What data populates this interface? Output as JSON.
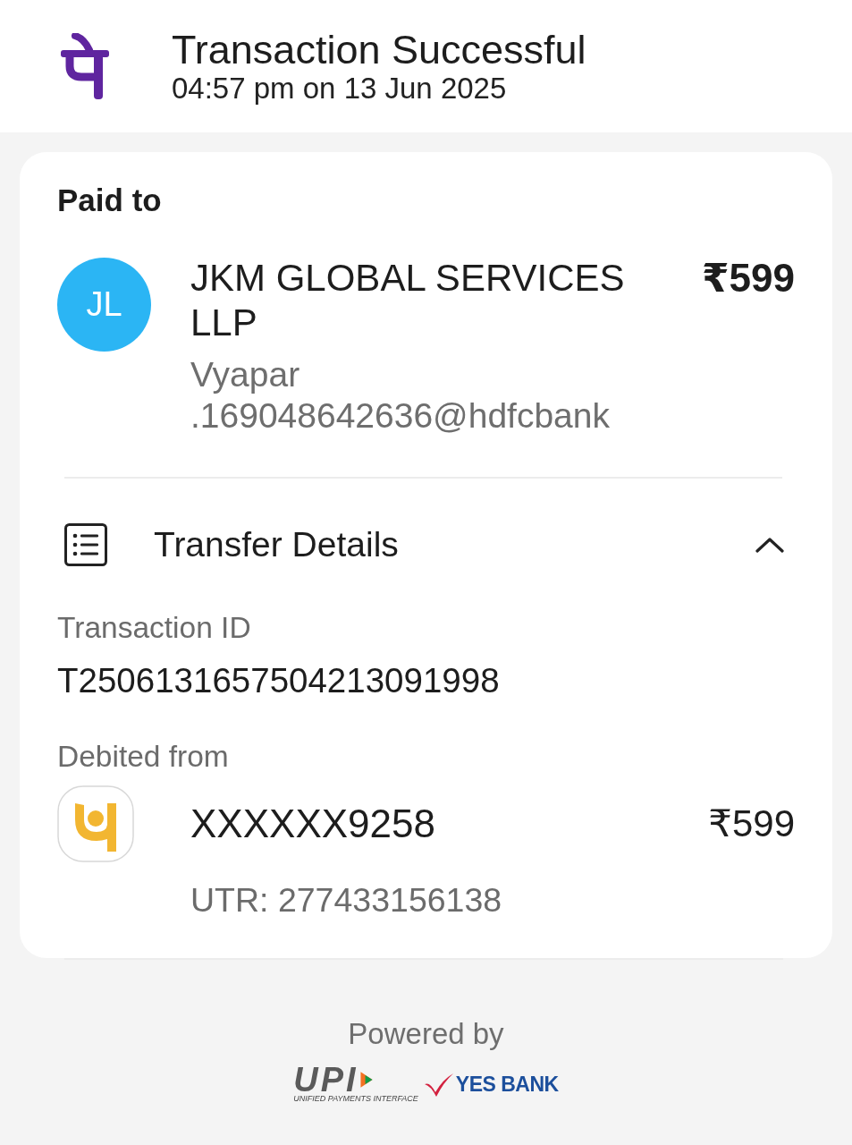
{
  "header": {
    "title": "Transaction Successful",
    "timestamp": "04:57 pm on 13 Jun 2025"
  },
  "paid_to": {
    "heading": "Paid to",
    "initials": "JL",
    "name": "JKM GLOBAL SERVICES LLP",
    "vpa": "Vyapar.169048642636@hdfcbank",
    "amount": "₹599"
  },
  "transfer_details": {
    "title": "Transfer Details",
    "expanded": true,
    "transaction_id": {
      "label": "Transaction ID",
      "value": "T2506131657504213091998"
    },
    "debited_from": {
      "label": "Debited from",
      "account": "XXXXXX9258",
      "amount": "₹599",
      "utr": "UTR: 277433156138"
    }
  },
  "footer": {
    "powered_by": "Powered by",
    "upi_logo": "UPI",
    "upi_tagline": "UNIFIED PAYMENTS INTERFACE",
    "bank_logo": "YES BANK"
  }
}
